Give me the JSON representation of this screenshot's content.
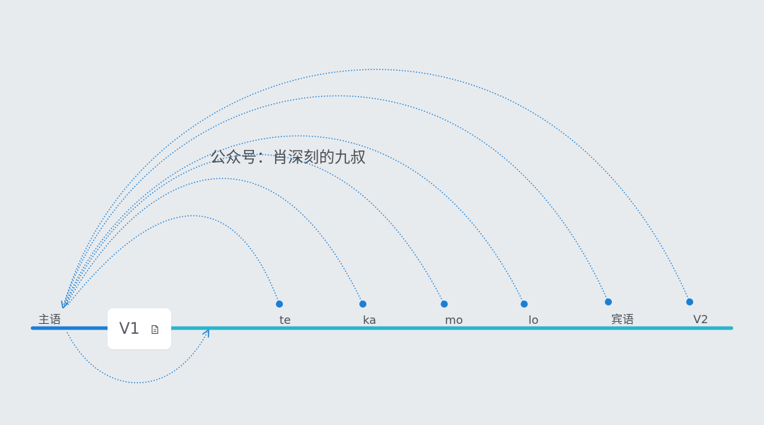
{
  "caption": "公众号：肖深刻的九叔",
  "timeline": {
    "left_color": "#1a7fd4",
    "right_color": "#29b4cc"
  },
  "arc_color": "#1a7fd4",
  "subject": {
    "label": "主语"
  },
  "verb_node": {
    "label": "V1",
    "icon": "note-icon"
  },
  "nodes": [
    {
      "id": "te",
      "label": "te"
    },
    {
      "id": "ka",
      "label": "ka"
    },
    {
      "id": "mo",
      "label": "mo"
    },
    {
      "id": "lo",
      "label": "lo"
    },
    {
      "id": "object",
      "label": "宾语"
    },
    {
      "id": "v2",
      "label": "V2"
    }
  ]
}
